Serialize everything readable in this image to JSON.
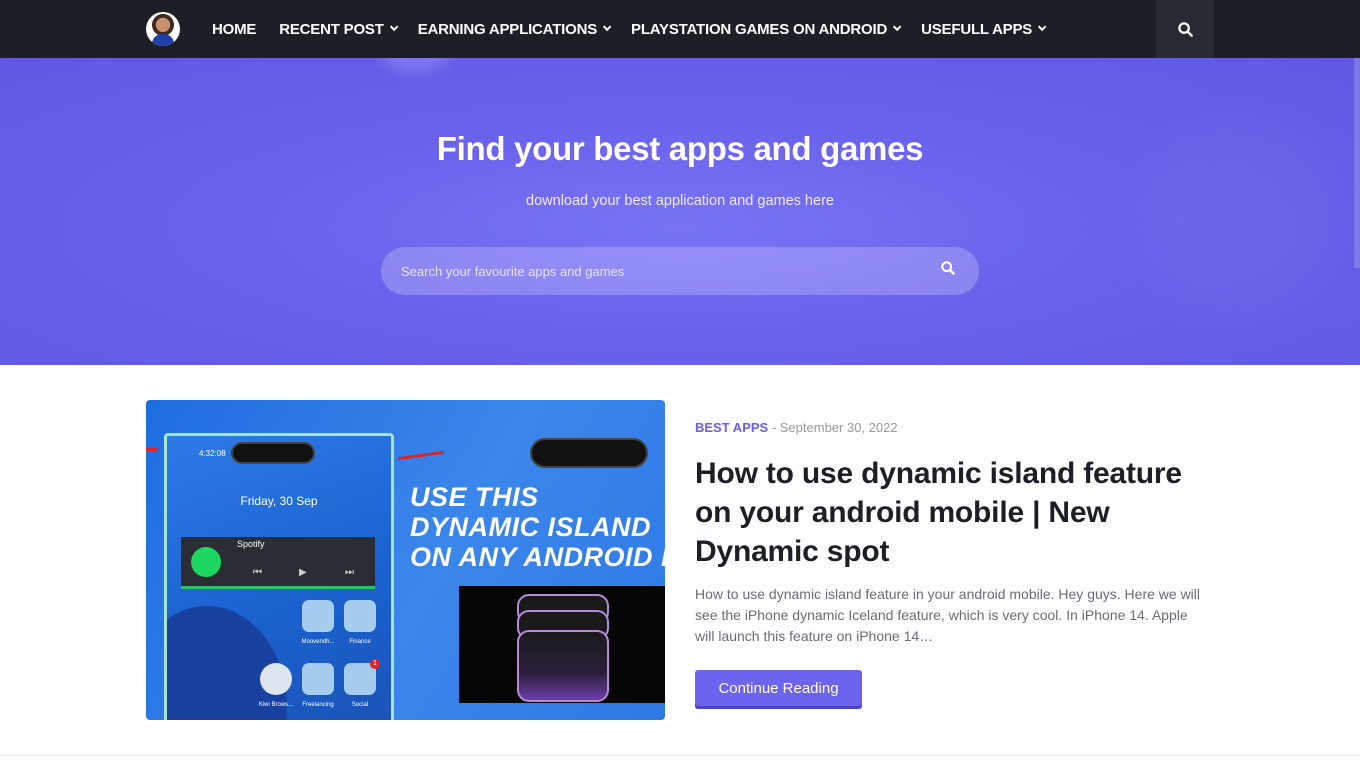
{
  "nav": {
    "items": [
      {
        "label": "HOME",
        "has_dropdown": false
      },
      {
        "label": "RECENT POST",
        "has_dropdown": true
      },
      {
        "label": "EARNING APPLICATIONS",
        "has_dropdown": true
      },
      {
        "label": "PLAYSTATION GAMES ON ANDROID",
        "has_dropdown": true
      },
      {
        "label": "USEFULL APPS",
        "has_dropdown": true
      }
    ],
    "search_icon": "search-icon",
    "avatar_icon": "profile-avatar"
  },
  "hero": {
    "title": "Find your best apps and games",
    "subtitle": "download your best application and games here",
    "search_placeholder": "Search your favourite apps and games",
    "search_icon": "search-icon"
  },
  "post": {
    "category": "BEST APPS",
    "separator": " - ",
    "date": "September 30, 2022",
    "title": "How to use dynamic island feature on your android mobile | New Dynamic spot",
    "excerpt": "How to use dynamic island feature in your android mobile. Hey guys. Here we will see the iPhone dynamic Iceland feature, which is very cool. In iPhone 14. Apple will launch this feature on iPhone 14…",
    "button_label": "Continue Reading",
    "thumbnail": {
      "headline_lines": [
        "USE THIS",
        "DYNAMIC ISLAND",
        "ON ANY ANDROID PH"
      ],
      "status_time": "4:32:08",
      "lock_date": "Friday, 30 Sep",
      "player_label": "Spotify",
      "apps": [
        "Moovendh...",
        "Finance",
        "Kiwi Brows...",
        "Freelancing",
        "Social"
      ],
      "badge_count": "1"
    }
  },
  "colors": {
    "nav_bg": "#1c1f26",
    "hero_bg": "#6b63ec",
    "accent": "#6c63ef",
    "title_text": "#1c1f26"
  }
}
